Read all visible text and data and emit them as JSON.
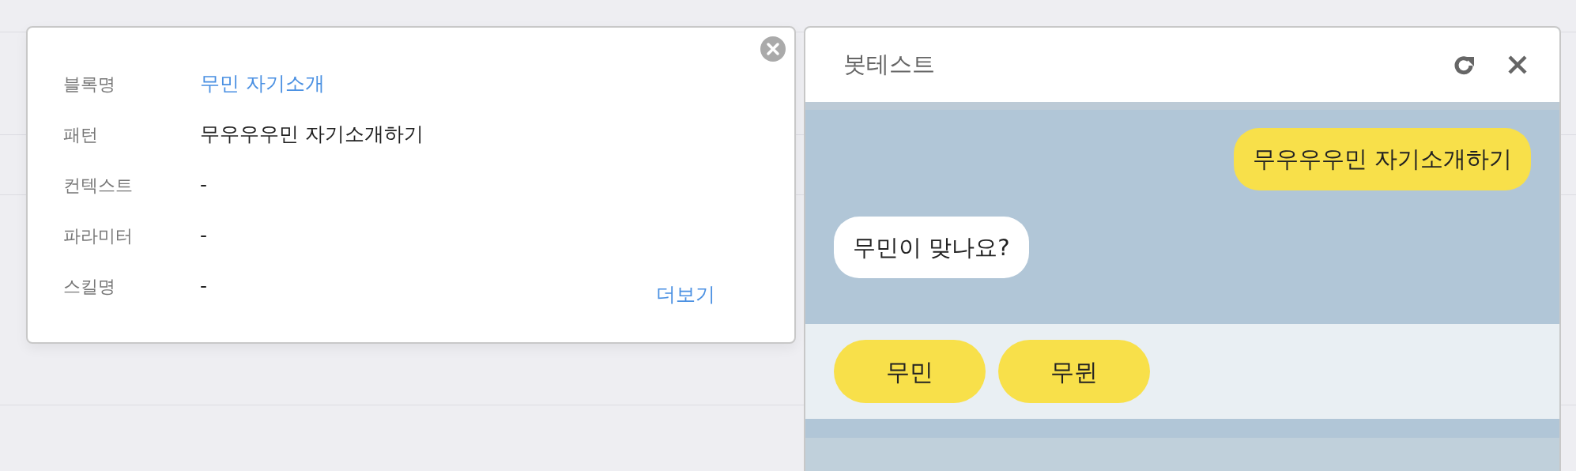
{
  "block_popup": {
    "fields": [
      {
        "label": "블록명",
        "value": "무민 자기소개",
        "kind": "link"
      },
      {
        "label": "패턴",
        "value": "무우우우민 자기소개하기",
        "kind": "text"
      },
      {
        "label": "컨텍스트",
        "value": "-",
        "kind": "text"
      },
      {
        "label": "파라미터",
        "value": "-",
        "kind": "text"
      },
      {
        "label": "스킬명",
        "value": "-",
        "kind": "text"
      }
    ],
    "more_link": "더보기"
  },
  "bot_test": {
    "title": "봇테스트",
    "messages": [
      {
        "kind": "user",
        "text": "무우우우민 자기소개하기"
      },
      {
        "kind": "bot",
        "text": "무민이 맞나요?"
      }
    ],
    "quick_replies": [
      "무민",
      "무뮌"
    ]
  }
}
